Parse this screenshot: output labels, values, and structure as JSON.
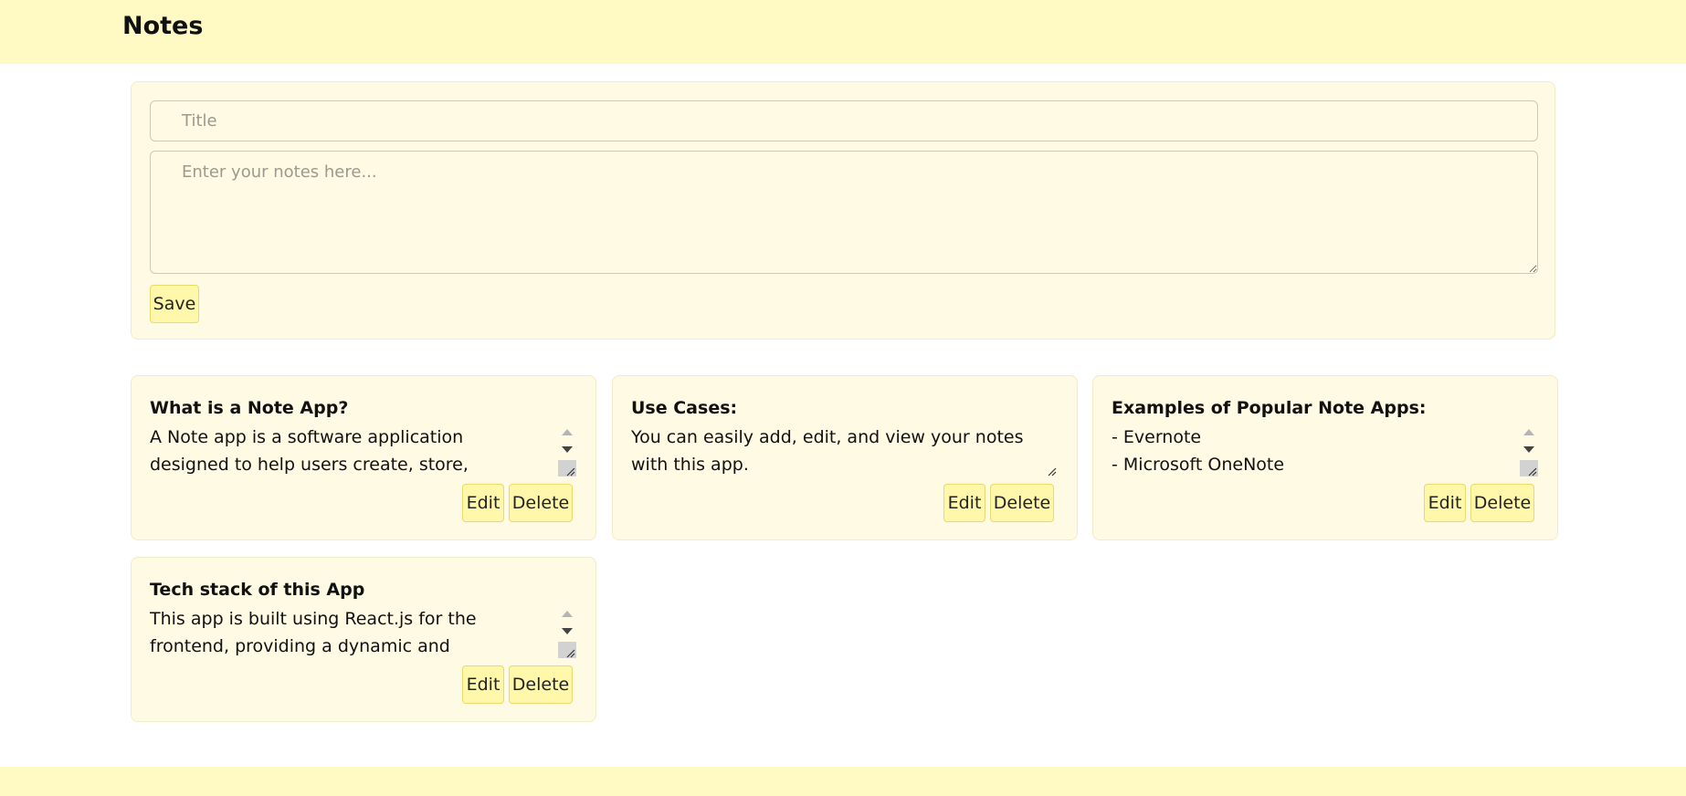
{
  "header": {
    "title": "Notes"
  },
  "form": {
    "title_placeholder": "Title",
    "title_value": "",
    "notes_placeholder": "Enter your notes here...",
    "notes_value": "",
    "save_label": "Save"
  },
  "notes": [
    {
      "title": "What is a Note App?",
      "body": "A Note app is a software application designed to help users create, store, organize, and manage",
      "edit_label": "Edit",
      "delete_label": "Delete"
    },
    {
      "title": "Use Cases:",
      "body": "You can easily add, edit, and view your notes with this app.",
      "edit_label": "Edit",
      "delete_label": "Delete"
    },
    {
      "title": "Examples of Popular Note Apps:",
      "body": "- Evernote\n- Microsoft OneNote",
      "edit_label": "Edit",
      "delete_label": "Delete"
    },
    {
      "title": "Tech stack of this App",
      "body": "This app is built using React.js for the frontend, providing a dynamic and responsive user",
      "edit_label": "Edit",
      "delete_label": "Delete"
    }
  ],
  "colors": {
    "header_bg": "#fff9c4",
    "card_bg": "#fefae3",
    "button_bg": "#fff7aa"
  }
}
